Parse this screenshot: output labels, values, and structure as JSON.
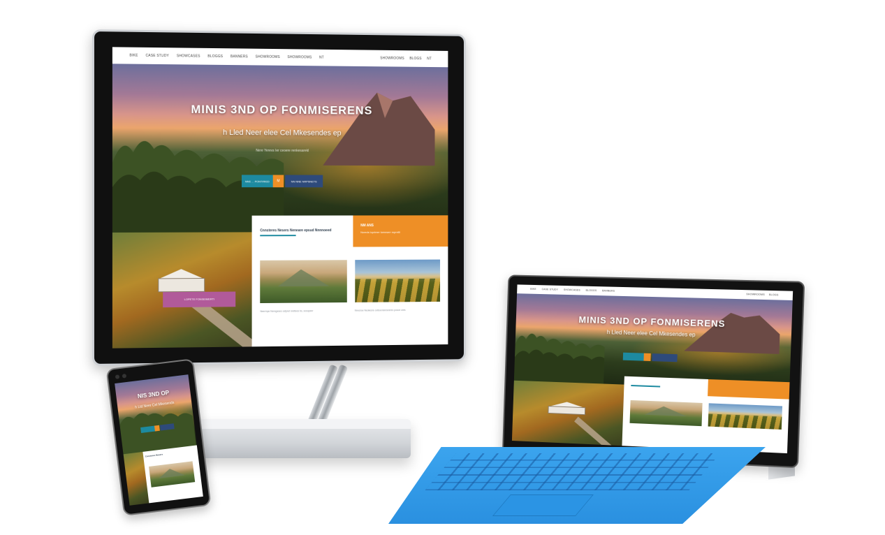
{
  "site": {
    "nav": {
      "left_items": [
        "BIKE",
        "CASE STUDY",
        "SHOWCASES",
        "BLOGGS",
        "BANNERS",
        "SHOWROOMS",
        "SHOWROOMS",
        "NT"
      ],
      "right_items": [
        "SHOWROOMS",
        "BLOGS",
        "NT"
      ]
    },
    "hero": {
      "title": "MINIS 3ND OP FONMISERENS",
      "subtitle": "h Lled Neer elee  Cel Mkesendes  ep",
      "small_text": "Nere Yerevs Ier ceoere renkesarekl",
      "primary_button": "NNE ... PONTIRIED",
      "accent_button": "M",
      "secondary_button": "NN NNE NRPSNETS"
    },
    "badge": "LOPETE FONSEIMERTI",
    "content": {
      "heading": "Cnnsteres Nesers Neneare epsud Nnnnoeed",
      "card_title": "NM ANS",
      "card_text": "Noreds Ioprimer tomeserr reprettt",
      "caption_a": "Neermpe Neregeses ostpret nrettees bs, sosopeer",
      "caption_b": "Nnesroe Neokesre ootsoensreseeres posoe ores"
    }
  },
  "phone": {
    "title": "NIS 3ND OP",
    "subtitle": "h Ltd Neer Cel Mkesends",
    "heading": "Cnnsteres Nesers"
  },
  "tablet": {
    "title": "MINIS 3ND OP FONMISERENS",
    "subtitle": "h Lled Neer elee  Cel Mkesendes  ep"
  },
  "colors": {
    "accent_teal": "#1d8aa0",
    "accent_orange": "#ee8f26",
    "accent_navy": "#2e4a7a",
    "badge_magenta": "#b15a9a",
    "keyboard_blue": "#2a90e0"
  }
}
